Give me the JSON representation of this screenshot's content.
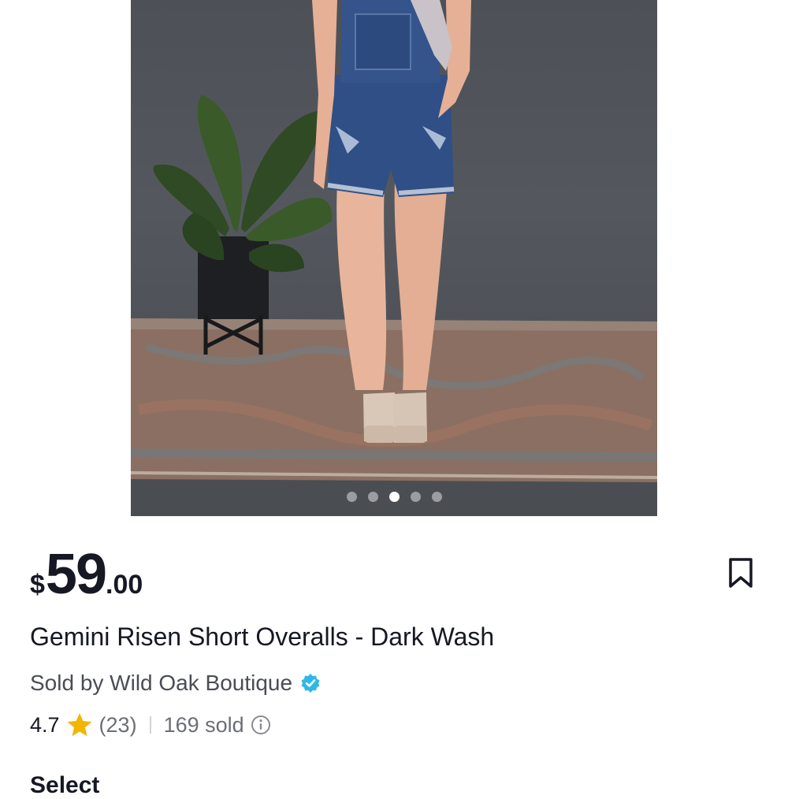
{
  "carousel": {
    "slide_count": 5,
    "active_index": 2,
    "image_icon": "product-photo"
  },
  "price": {
    "currency": "$",
    "integer": "59",
    "decimal": ".00"
  },
  "product": {
    "title": "Gemini Risen Short Overalls - Dark Wash"
  },
  "seller": {
    "label": "Sold by Wild Oak Boutique",
    "verified_icon": "verified-badge-icon",
    "verified_color": "#2fb8e6"
  },
  "rating": {
    "score": "4.7",
    "star_color": "#f2b600",
    "reviews": "(23)",
    "sold": "169 sold",
    "info_icon": "info-icon"
  },
  "actions": {
    "bookmark_icon": "bookmark-icon"
  },
  "section": {
    "select_label": "Select"
  }
}
